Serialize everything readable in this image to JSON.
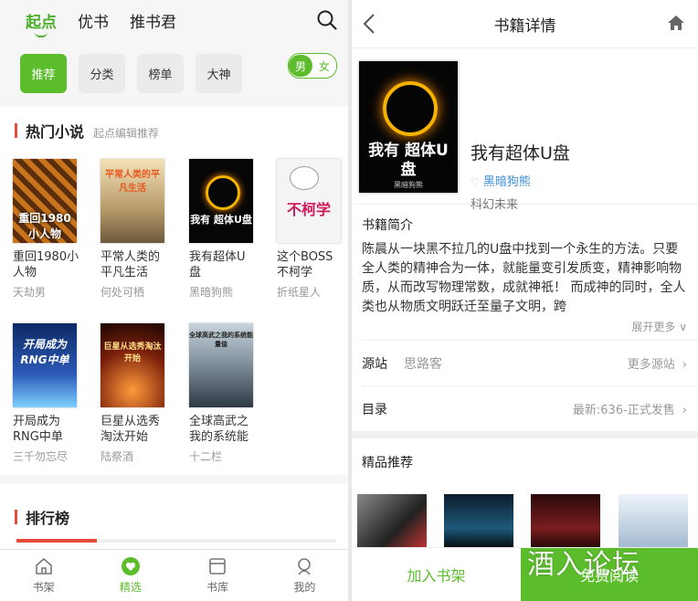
{
  "left": {
    "tabs": [
      {
        "label": "起点"
      },
      {
        "label": "优书"
      },
      {
        "label": "推书君"
      }
    ],
    "chips": [
      {
        "label": "推荐"
      },
      {
        "label": "分类"
      },
      {
        "label": "榜单"
      },
      {
        "label": "大神"
      }
    ],
    "gender": {
      "male": "男",
      "female": "女"
    },
    "hot": {
      "title": "热门小说",
      "subtitle": "起点编辑推荐",
      "books": [
        {
          "title": "重回1980小人物",
          "author": "天劫男",
          "cover_text": "重回1980 小人物"
        },
        {
          "title": "平常人类的平凡生活",
          "author": "何处可栖",
          "cover_text": "平常人类的平凡生活"
        },
        {
          "title": "我有超体U盘",
          "author": "黑暗狗熊",
          "cover_text": "我有 超体U盘"
        },
        {
          "title": "这个BOSS不柯学",
          "author": "折纸星人",
          "cover_text": "不柯学"
        },
        {
          "title": "开局成为RNG中单",
          "author": "三千勿忘尽",
          "cover_text": "开局成为 RNG中单"
        },
        {
          "title": "巨星从选秀淘汰开始",
          "author": "陆祭酒",
          "cover_text": "巨星从选秀淘汰开始"
        },
        {
          "title": "全球高武之我的系统能",
          "author": "十二栏",
          "cover_text": "全球高武之我的系统能量值"
        }
      ]
    },
    "ranking": {
      "title": "排行榜"
    },
    "bottom_nav": [
      {
        "label": "书架"
      },
      {
        "label": "精选"
      },
      {
        "label": "书库"
      },
      {
        "label": "我的"
      }
    ]
  },
  "right": {
    "header": {
      "title": "书籍详情"
    },
    "book": {
      "name": "我有超体U盘",
      "author": "黑暗狗熊",
      "category": "科幻未来",
      "cover_text": "我有 超体U盘",
      "cover_author": "黑暗狗熊"
    },
    "intro": {
      "heading": "书籍简介",
      "text": "陈晨从一块黑不拉几的U盘中找到一个永生的方法。只要全人类的精神合为一体，就能量变引发质变，精神影响物质，从而改写物理常数，成就神祇！ 而成神的同时，全人类也从物质文明跃迁至量子文明，跨",
      "more": "展开更多"
    },
    "source": {
      "key": "源站",
      "value": "思路客",
      "more": "更多源站"
    },
    "toc": {
      "key": "目录",
      "latest": "最新:636-正式发售"
    },
    "recommend": {
      "title": "精品推荐"
    },
    "actions": {
      "add": "加入书架",
      "read": "免费阅读"
    }
  },
  "watermark": "酒入论坛",
  "colors": {
    "accent": "#5cbd2c",
    "section_bar": "#e64b3c",
    "author_link": "#3d8fd8"
  }
}
